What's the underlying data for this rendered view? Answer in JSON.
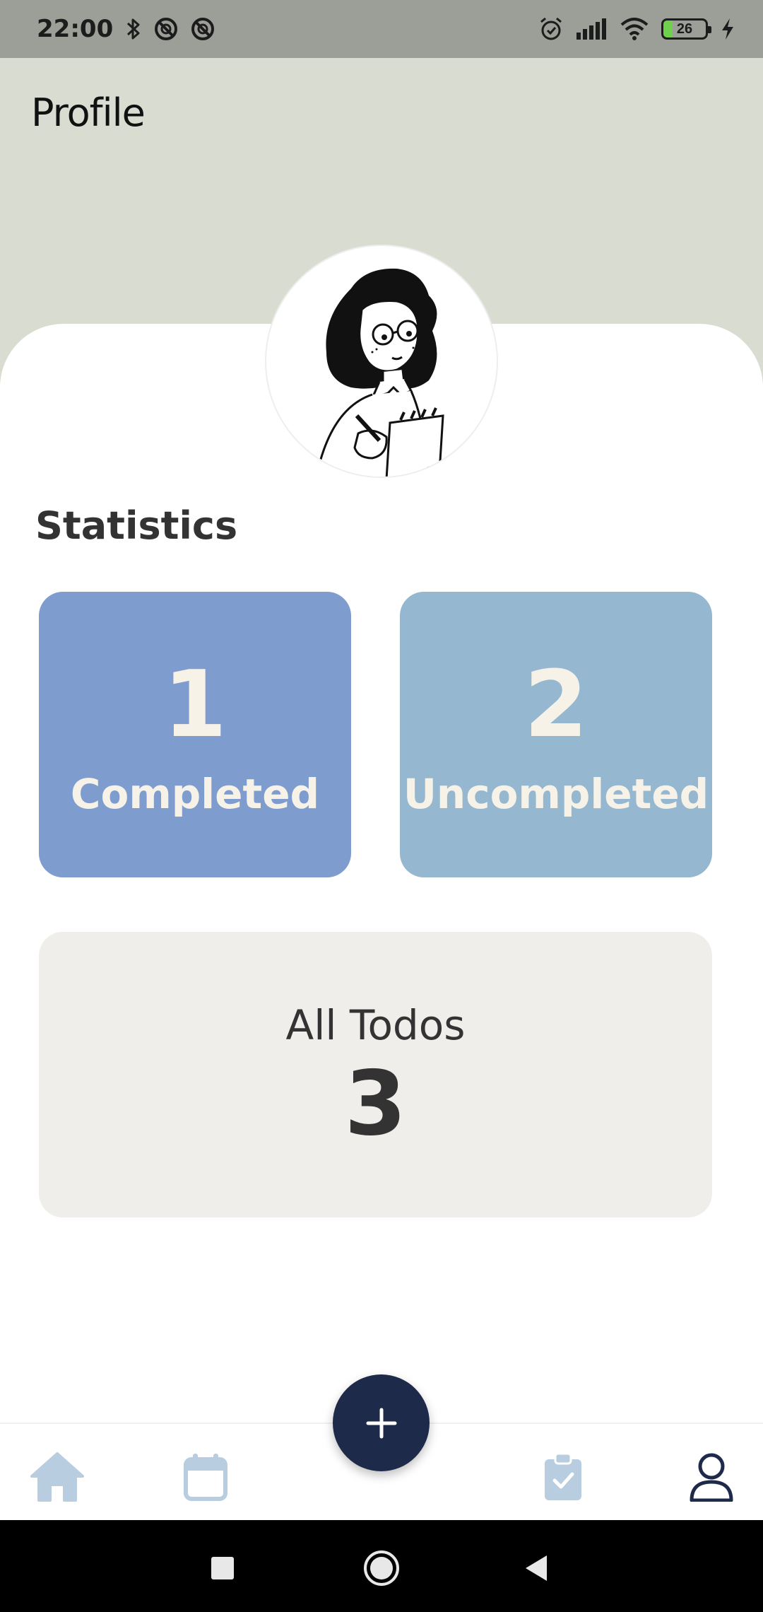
{
  "status_bar": {
    "time": "22:00",
    "battery": "26",
    "icons": [
      "bluetooth-icon",
      "dnd-icon",
      "dnd-icon",
      "alarm-icon",
      "signal-icon",
      "wifi-icon",
      "battery-icon",
      "charging-icon"
    ]
  },
  "header": {
    "title": "Profile",
    "background": "#d9ddd1"
  },
  "statistics": {
    "title": "Statistics",
    "completed": {
      "value": "1",
      "label": "Completed",
      "color": "#7f9ccf"
    },
    "uncompleted": {
      "value": "2",
      "label": "Uncompleted",
      "color": "#96b7d0"
    },
    "all": {
      "label": "All Todos",
      "value": "3",
      "color": "#efeeeb"
    }
  },
  "bottom_nav": {
    "items": [
      {
        "icon": "home-icon",
        "active": false
      },
      {
        "icon": "calendar-icon",
        "active": false
      },
      {
        "icon": "clipboard-check-icon",
        "active": false
      },
      {
        "icon": "profile-icon",
        "active": true
      }
    ],
    "fab_icon": "plus-icon",
    "fab_color": "#1e2a4a",
    "inactive_color": "#b8cde0",
    "active_color": "#1e2a4a"
  },
  "system_nav": [
    "recents-icon",
    "home-circle-icon",
    "back-icon"
  ]
}
